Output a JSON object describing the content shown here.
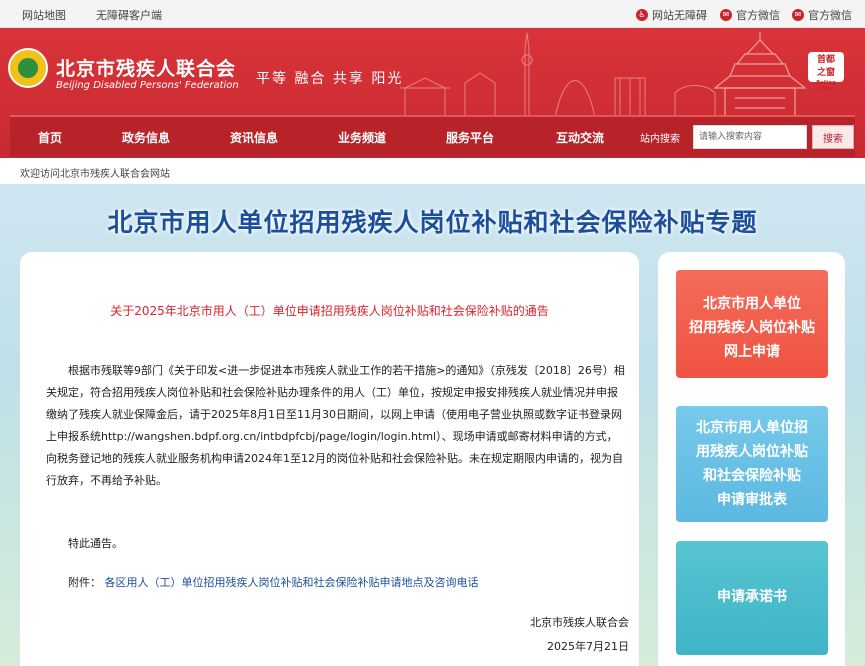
{
  "topbar": {
    "sitemap": "网站地图",
    "accessible_client": "无障碍客户端",
    "site_accessible": "网站无障碍",
    "wechat_1": "官方微信",
    "wechat_2": "官方微信"
  },
  "header": {
    "site_name": "北京市残疾人联合会",
    "site_name_en": "Beijing Disabled Persons' Federation",
    "slogan": "平等 融合 共享 阳光",
    "badge_top": "首都",
    "badge_mid": "之窗",
    "badge_bottom": "Beijing China"
  },
  "nav": {
    "items": [
      "首页",
      "政务信息",
      "资讯信息",
      "业务频道",
      "服务平台",
      "互动交流"
    ],
    "search_label": "站内搜索",
    "search_placeholder": "请输入搜索内容",
    "search_button": "搜索"
  },
  "welcome": "欢迎访问北京市残疾人联合会网站",
  "banner_title": "北京市用人单位招用残疾人岗位补贴和社会保险补贴专题",
  "article": {
    "title": "关于2025年北京市用人（工）单位申请招用残疾人岗位补贴和社会保险补贴的通告",
    "body": "根据市残联等9部门《关于印发<进一步促进本市残疾人就业工作的若干措施>的通知》（京残发〔2018〕26号）相关规定，符合招用残疾人岗位补贴和社会保险补贴办理条件的用人（工）单位，按规定申报安排残疾人就业情况并申报缴纳了残疾人就业保障金后，请于2025年8月1日至11月30日期间，以网上申请（使用电子营业执照或数字证书登录网上申报系统http://wangshen.bdpf.org.cn/intbdpfcbj/page/login/login.html）、现场申请或邮寄材料申请的方式，向税务登记地的残疾人就业服务机构申请2024年1至12月的岗位补贴和社会保险补贴。未在规定期限内申请的，视为自行放弃，不再给予补贴。",
    "closing": "特此通告。",
    "attachment_label": "附件：",
    "attachment_link": "各区用人（工）单位招用残疾人岗位补贴和社会保险补贴申请地点及咨询电话",
    "signature_org": "北京市残疾人联合会",
    "signature_date": "2025年7月21日"
  },
  "sidebar": {
    "online_apply": [
      "北京市用人单位",
      "招用残疾人岗位补贴",
      "网上申请"
    ],
    "approval_form": [
      "北京市用人单位招",
      "用残疾人岗位补贴",
      "和社会保险补贴",
      "申请审批表"
    ],
    "commitment": [
      "申请承诺书"
    ]
  },
  "colors": {
    "brand_red": "#c8242b",
    "title_blue": "#1b4f9c",
    "notice_red": "#d9232c"
  }
}
